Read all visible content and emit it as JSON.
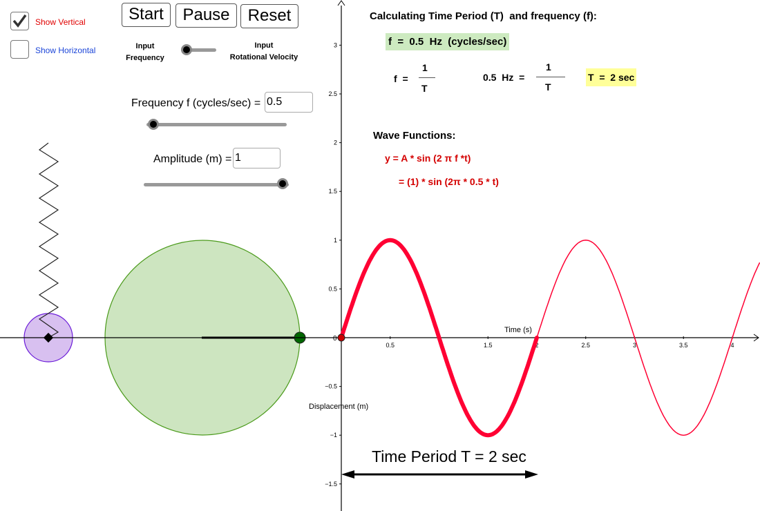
{
  "controls": {
    "show_vertical": {
      "label": "Show Vertical",
      "checked": true,
      "color": "#e00000"
    },
    "show_horizontal": {
      "label": "Show Horizontal",
      "checked": false,
      "color": "#1a44d8"
    },
    "start_label": "Start",
    "pause_label": "Pause",
    "reset_label": "Reset",
    "mode_left_label_1": "Input",
    "mode_left_label_2": "Frequency",
    "mode_right_label_1": "Input",
    "mode_right_label_2": "Rotational Velocity",
    "mode_toggle_value": 0,
    "frequency_label": "Frequency  f (cycles/sec) =",
    "frequency_value": "0.5",
    "frequency_slider_fraction": 0.04,
    "amplitude_label": "Amplitude (m) =",
    "amplitude_value": "1",
    "amplitude_slider_fraction": 1.0
  },
  "info": {
    "heading": "Calculating Time Period (T)  and frequency (f):",
    "f_value": "f  =  0.5  Hz  (cycles/sec)",
    "f_eq_left": "f  =",
    "one": "1",
    "T": "T",
    "f_eq_mid": "0.5  Hz  =",
    "T_result": "T  =  2 sec",
    "wave_heading": "Wave Functions:",
    "wave_eq_1": "y = A * sin (2 π f *t)",
    "wave_eq_2": "= (1) * sin (2π * 0.5 * t)",
    "highlight_green": "#cdeac0",
    "highlight_yellow": "#ffff99"
  },
  "graph": {
    "x_axis_label": "Time (s)",
    "y_axis_label": "Displacement (m)",
    "x_ticks": [
      "0.5",
      "1.5",
      "2",
      "2.5",
      "3",
      "3.5",
      "4"
    ],
    "y_ticks": [
      "3",
      "2.5",
      "2",
      "1.5",
      "1",
      "0.5",
      "0",
      "−0.5",
      "−1",
      "−1.5"
    ],
    "origin_label": "0",
    "amplitude": 1,
    "frequency": 0.5,
    "highlighted_range": [
      0,
      2
    ],
    "curve_color": "#ff0033",
    "period_annotation": "Time Period T  = 2  sec"
  },
  "scene": {
    "circle_fill": "#cde5c0",
    "circle_stroke": "#4a9a1a",
    "mass_fill": "#d8c0f0",
    "mass_stroke": "#6a1ad8",
    "point_color": "#006600"
  }
}
